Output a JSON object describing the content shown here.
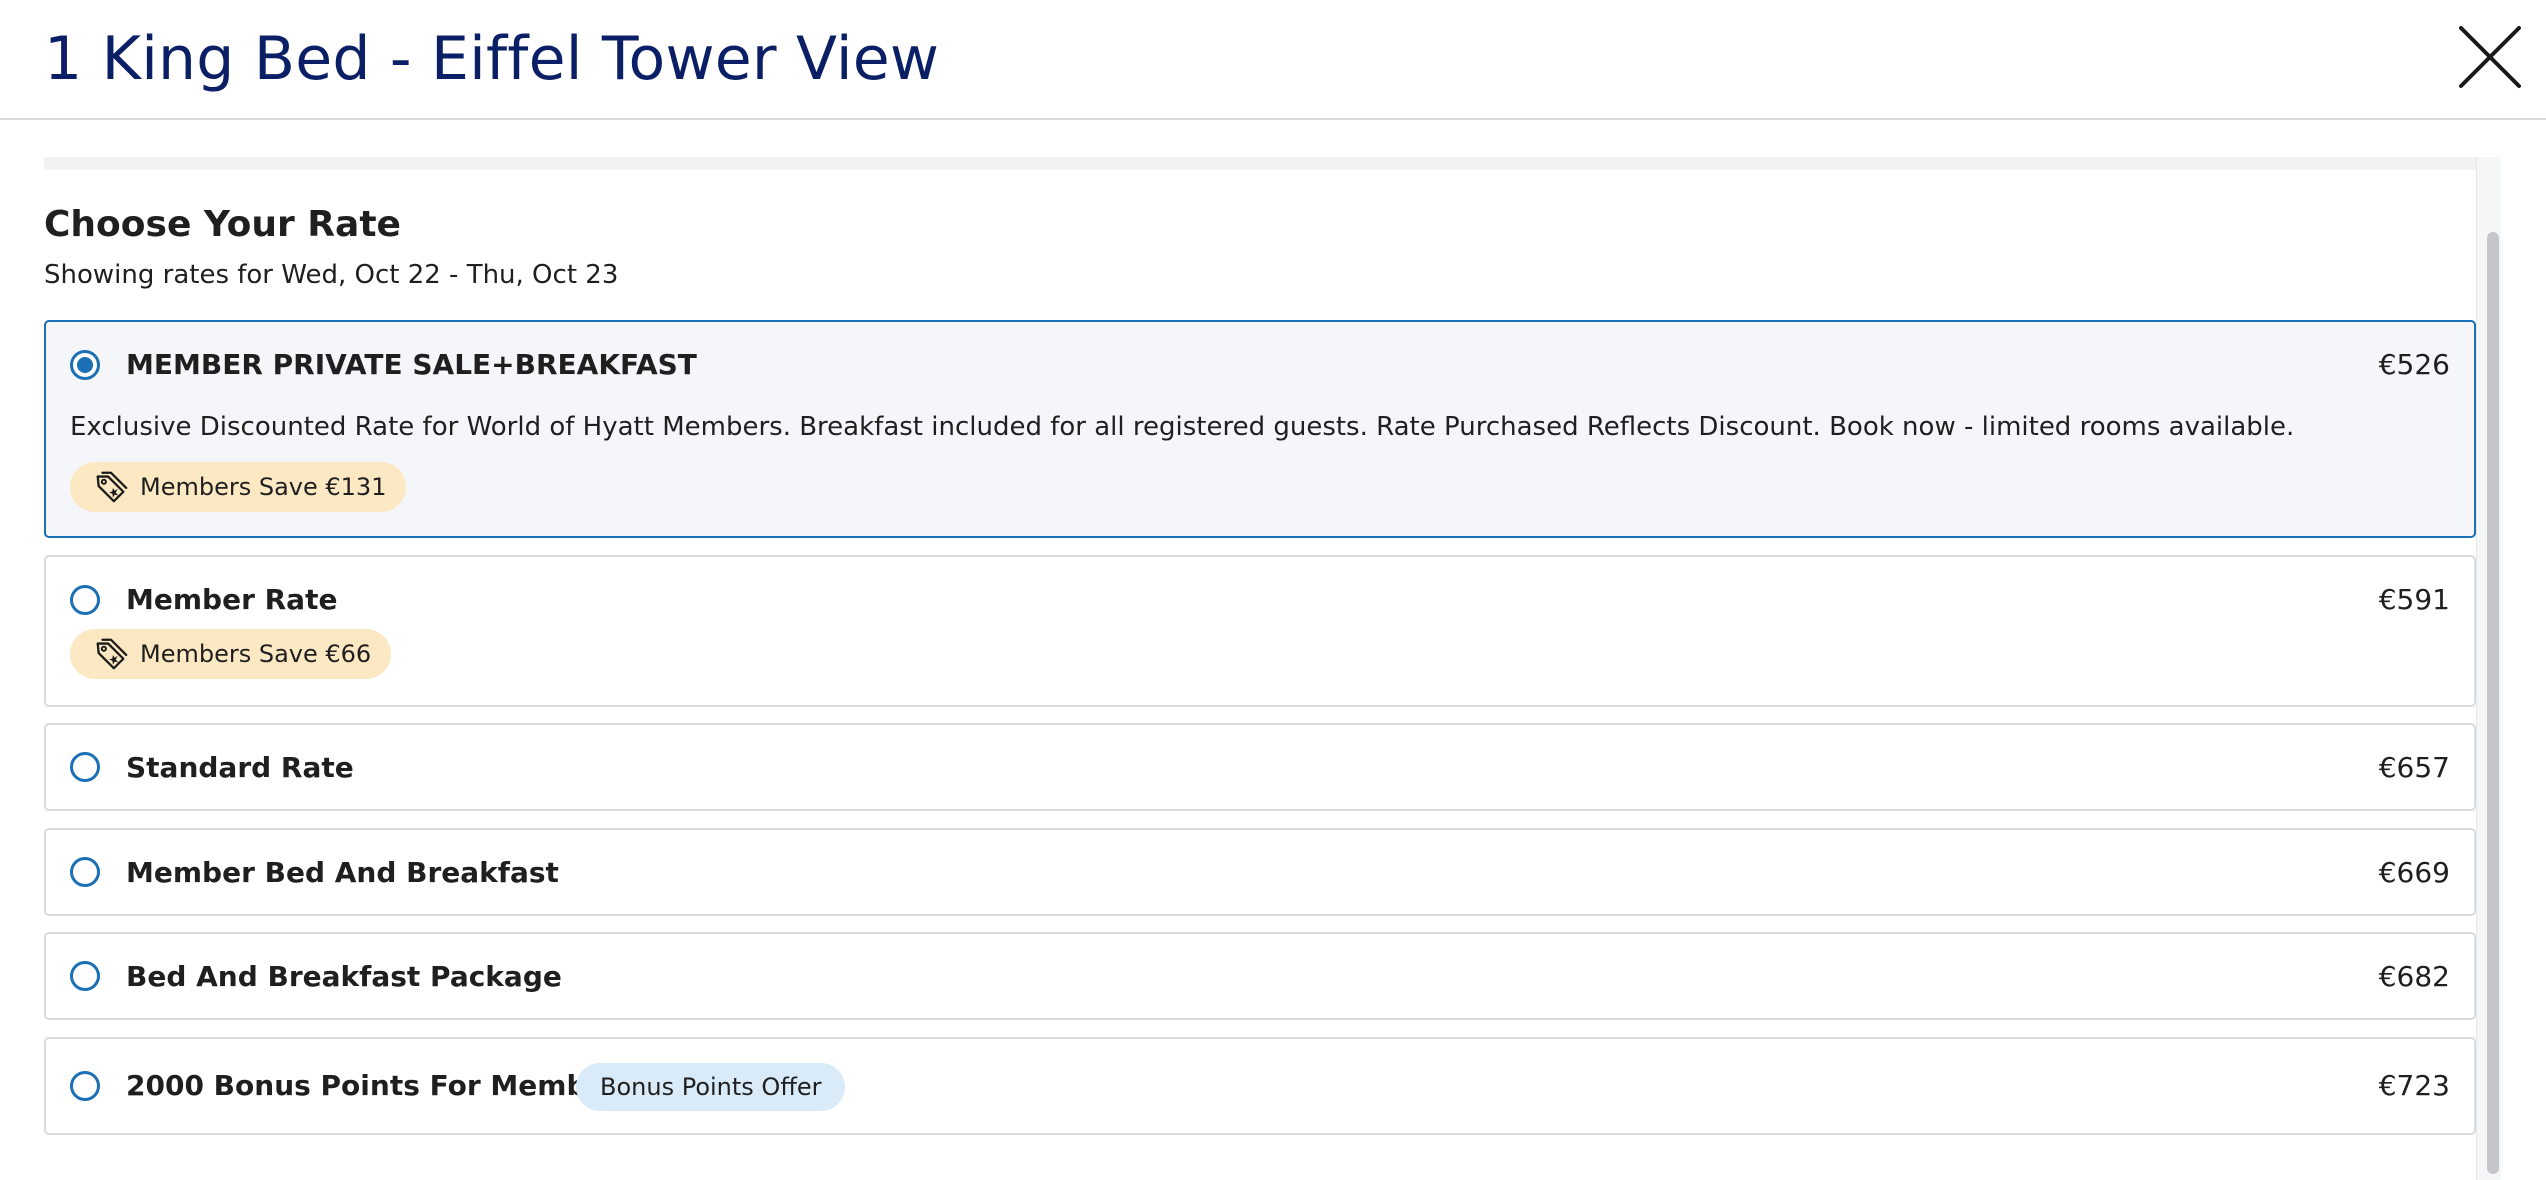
{
  "modal": {
    "title": "1 King Bed - Eiffel Tower View",
    "close_label": "Close"
  },
  "rates_section": {
    "title": "Choose Your Rate",
    "subtitle": "Showing rates for Wed, Oct 22 - Thu, Oct 23"
  },
  "rates": [
    {
      "name": "MEMBER PRIVATE SALE+BREAKFAST",
      "price": "€526",
      "selected": true,
      "description": "Exclusive Discounted Rate for World of Hyatt Members. Breakfast included for all registered guests. Rate Purchased Reflects Discount. Book now - limited rooms available.",
      "badge": "Members Save €131"
    },
    {
      "name": "Member Rate",
      "price": "€591",
      "selected": false,
      "badge": "Members Save €66"
    },
    {
      "name": "Standard Rate",
      "price": "€657",
      "selected": false
    },
    {
      "name": "Member Bed And Breakfast",
      "price": "€669",
      "selected": false
    },
    {
      "name": "Bed And Breakfast Package",
      "price": "€682",
      "selected": false
    },
    {
      "name": "2000 Bonus Points For Members",
      "price": "€723",
      "selected": false,
      "offer_badge": "Bonus Points Offer"
    }
  ],
  "colors": {
    "title_navy": "#0b1f66",
    "accent_blue": "#1b6fb5",
    "member_badge_bg": "#fde8c4",
    "bonus_badge_bg": "#d9eaf8",
    "selected_card_bg": "#f4f6fa"
  },
  "icons": {
    "close": "close-icon",
    "member_tag": "price-tag-icon"
  }
}
